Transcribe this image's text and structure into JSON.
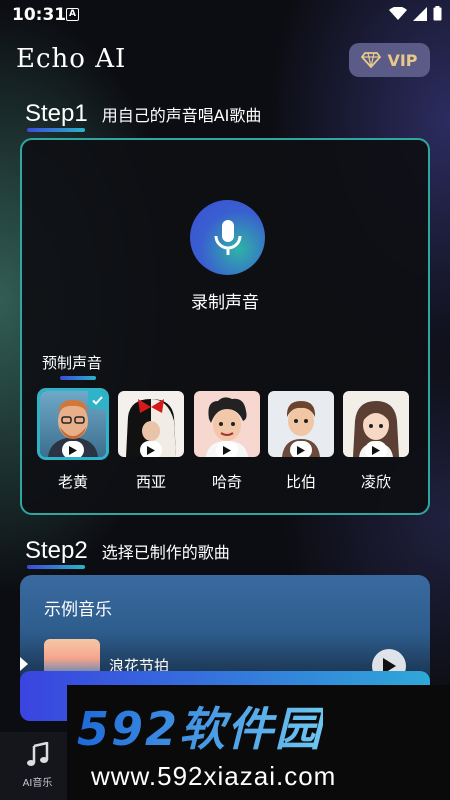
{
  "status_bar": {
    "time": "10:31",
    "notification_icon_letter": "A"
  },
  "header": {
    "title": "Echo AI",
    "vip_label": "VIP"
  },
  "step1": {
    "label": "Step1",
    "description": "用自己的声音唱AI歌曲"
  },
  "record": {
    "label": "录制声音",
    "preset_title": "预制声音"
  },
  "voices": [
    {
      "name": "老黄",
      "selected": true
    },
    {
      "name": "西亚",
      "selected": false
    },
    {
      "name": "哈奇",
      "selected": false
    },
    {
      "name": "比伯",
      "selected": false
    },
    {
      "name": "凌欣",
      "selected": false
    }
  ],
  "step2": {
    "label": "Step2",
    "description": "选择已制作的歌曲"
  },
  "example": {
    "title": "示例音乐",
    "song_title": "浪花节拍"
  },
  "bottom_nav": {
    "tab_label": "AI音乐"
  },
  "watermark": {
    "brand": "592软件园",
    "url": "www.592xiazai.com"
  },
  "colors": {
    "accent_teal": "#2fb3c8",
    "accent_blue": "#3a4fd6",
    "vip_gold": "#e8c98a"
  }
}
